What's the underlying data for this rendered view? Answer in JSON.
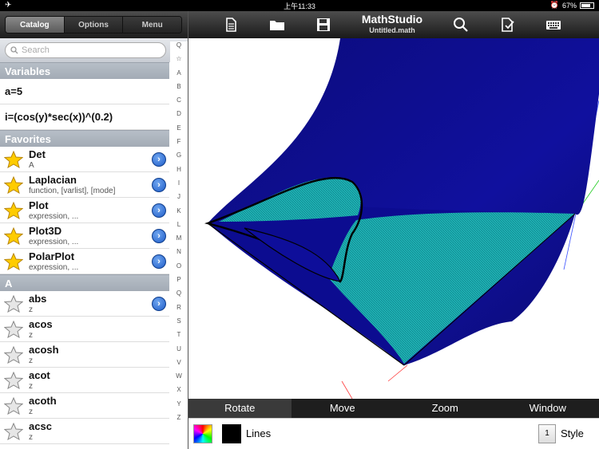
{
  "status": {
    "left_icon": "airplane-icon",
    "time": "上午11:33",
    "battery": "67%",
    "battery_level": 0.67
  },
  "tabs": [
    {
      "label": "Catalog",
      "active": true
    },
    {
      "label": "Options",
      "active": false
    },
    {
      "label": "Menu",
      "active": false
    }
  ],
  "search": {
    "placeholder": "Search"
  },
  "sections": {
    "variables": "Variables",
    "favorites": "Favorites",
    "a": "A"
  },
  "variables": [
    "a=5",
    "i=(cos(y)*sec(x))^(0.2)"
  ],
  "favorites": [
    {
      "title": "Det",
      "sub": "A"
    },
    {
      "title": "Laplacian",
      "sub": "function, [varlist], [mode]"
    },
    {
      "title": "Plot",
      "sub": "expression, ..."
    },
    {
      "title": "Plot3D",
      "sub": "expression, ..."
    },
    {
      "title": "PolarPlot",
      "sub": "expression, ..."
    }
  ],
  "a_items": [
    {
      "title": "abs",
      "sub": "z"
    },
    {
      "title": "acos",
      "sub": "z"
    },
    {
      "title": "acosh",
      "sub": "z"
    },
    {
      "title": "acot",
      "sub": "z"
    },
    {
      "title": "acoth",
      "sub": "z"
    },
    {
      "title": "acsc",
      "sub": "z"
    }
  ],
  "index_letters": [
    "Q",
    "☆",
    "A",
    "B",
    "C",
    "D",
    "E",
    "F",
    "G",
    "H",
    "I",
    "J",
    "K",
    "L",
    "M",
    "N",
    "O",
    "P",
    "Q",
    "R",
    "S",
    "T",
    "U",
    "V",
    "W",
    "X",
    "Y",
    "Z"
  ],
  "app": {
    "title": "MathStudio",
    "subtitle": "Untitled.math"
  },
  "modes": [
    {
      "label": "Rotate",
      "active": true
    },
    {
      "label": "Move",
      "active": false
    },
    {
      "label": "Zoom",
      "active": false
    },
    {
      "label": "Window",
      "active": false
    }
  ],
  "style": {
    "lines_label": "Lines",
    "style_num": "1",
    "style_label": "Style"
  },
  "colors": {
    "surface_dark": "#0a0a8c",
    "surface_cyan": "#1fb5b5",
    "accent": "#1e5bc7"
  }
}
